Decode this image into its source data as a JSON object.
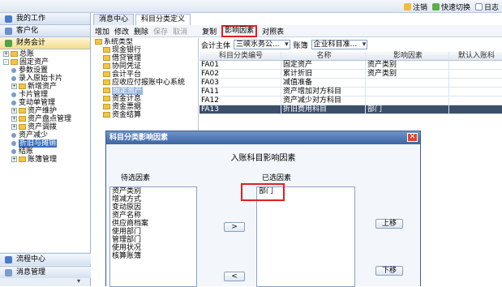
{
  "topbar": {
    "logout": "注销",
    "quick_switch": "快速切换",
    "log": "日志"
  },
  "leftnav": {
    "headers": [
      "我的工作",
      "客户化",
      "财务会计"
    ],
    "tree": [
      {
        "label": "总账",
        "level": 0,
        "kind": "folder",
        "expand": "+"
      },
      {
        "label": "固定资产",
        "level": 0,
        "kind": "folder",
        "expand": "-"
      },
      {
        "label": "参数设置",
        "level": 1,
        "kind": "leaf"
      },
      {
        "label": "录入原始卡片",
        "level": 1,
        "kind": "leaf"
      },
      {
        "label": "新增资产",
        "level": 1,
        "kind": "folder",
        "expand": "+"
      },
      {
        "label": "卡片管理",
        "level": 1,
        "kind": "leaf"
      },
      {
        "label": "变动单管理",
        "level": 1,
        "kind": "leaf"
      },
      {
        "label": "资产维护",
        "level": 1,
        "kind": "folder",
        "expand": "+"
      },
      {
        "label": "资产盘点管理",
        "level": 1,
        "kind": "folder",
        "expand": "+"
      },
      {
        "label": "资产调拨",
        "level": 1,
        "kind": "folder",
        "expand": "+"
      },
      {
        "label": "资产减少",
        "level": 1,
        "kind": "leaf"
      },
      {
        "label": "折旧与摊销",
        "level": 1,
        "kind": "leaf",
        "selected": true
      },
      {
        "label": "结账",
        "level": 1,
        "kind": "leaf"
      },
      {
        "label": "账簿管理",
        "level": 1,
        "kind": "folder",
        "expand": "+"
      }
    ],
    "footers": [
      "流程中心",
      "消息管理"
    ]
  },
  "tabs": [
    "消息中心",
    "科目分类定义"
  ],
  "toolbar": {
    "add": "增加",
    "edit": "修改",
    "delete": "删除",
    "save": "保存",
    "cancel": "取消",
    "copy": "复制",
    "influence": "影响因素",
    "mapping": "对照表"
  },
  "categories": [
    {
      "label": "系统类型",
      "kind": "root"
    },
    {
      "label": "现金银行"
    },
    {
      "label": "借贷管理"
    },
    {
      "label": "协同凭证"
    },
    {
      "label": "会计平台"
    },
    {
      "label": "应收应付报账中心系统"
    },
    {
      "label": "固定资产",
      "selected": true
    },
    {
      "label": "资金计息"
    },
    {
      "label": "资金票据"
    },
    {
      "label": "资金结算"
    }
  ],
  "filter": {
    "entity_label": "会计主体",
    "entity_value": "三峡水务公...",
    "book_label": "账簿",
    "book_value": "企业科目准..."
  },
  "grid": {
    "headers": [
      "科目分类编号",
      "名称",
      "影响因素",
      "默认入账科"
    ],
    "rows": [
      [
        "FA01",
        "固定资产",
        "资产类别",
        ""
      ],
      [
        "FA02",
        "累计折旧",
        "资产类别",
        ""
      ],
      [
        "FA03",
        "减值准备",
        "",
        ""
      ],
      [
        "FA11",
        "资产增加对方科目",
        "",
        ""
      ],
      [
        "FA12",
        "资产减少对方科目",
        "",
        ""
      ],
      [
        "FA13",
        "折旧费用科目",
        "部门",
        ""
      ]
    ],
    "selected_index": 5
  },
  "dialog": {
    "title": "科目分类影响因素",
    "heading": "入账科目影响因素",
    "pending_label": "待选因素",
    "selected_label": "已选因素",
    "pending": [
      "资产类别",
      "增减方式",
      "变动原因",
      "资产名称",
      "供应商档案",
      "使用部门",
      "管理部门",
      "使用状况",
      "核算账簿"
    ],
    "selected": [
      "部门"
    ],
    "btn_add": ">",
    "btn_remove": "<",
    "btn_up": "上移",
    "btn_down": "下移"
  }
}
